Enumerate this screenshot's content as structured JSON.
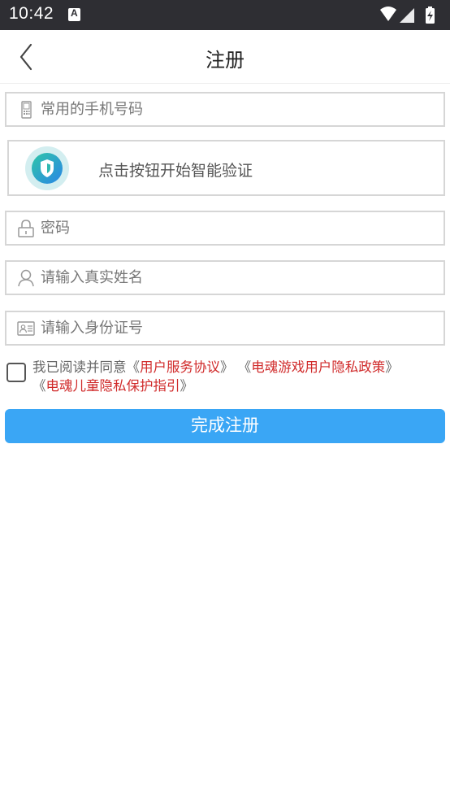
{
  "status_bar": {
    "time": "10:42",
    "notification_letter": "A"
  },
  "header": {
    "title": "注册"
  },
  "form": {
    "phone_placeholder": "常用的手机号码",
    "verify_label": "点击按钮开始智能验证",
    "password_placeholder": "密码",
    "name_placeholder": "请输入真实姓名",
    "id_placeholder": "请输入身份证号"
  },
  "agreement": {
    "prefix": "我已阅读并同意",
    "link1": "用户服务协议",
    "link2": "电魂游戏用户隐私政策",
    "link3": "电魂儿童隐私保护指引",
    "open_bracket": "《",
    "close_bracket": "》"
  },
  "submit_label": "完成注册",
  "colors": {
    "accent": "#3aa6f5",
    "link": "#d02a2a",
    "verify_gradient_start": "#2fc6a8",
    "verify_gradient_end": "#2b86e6"
  }
}
